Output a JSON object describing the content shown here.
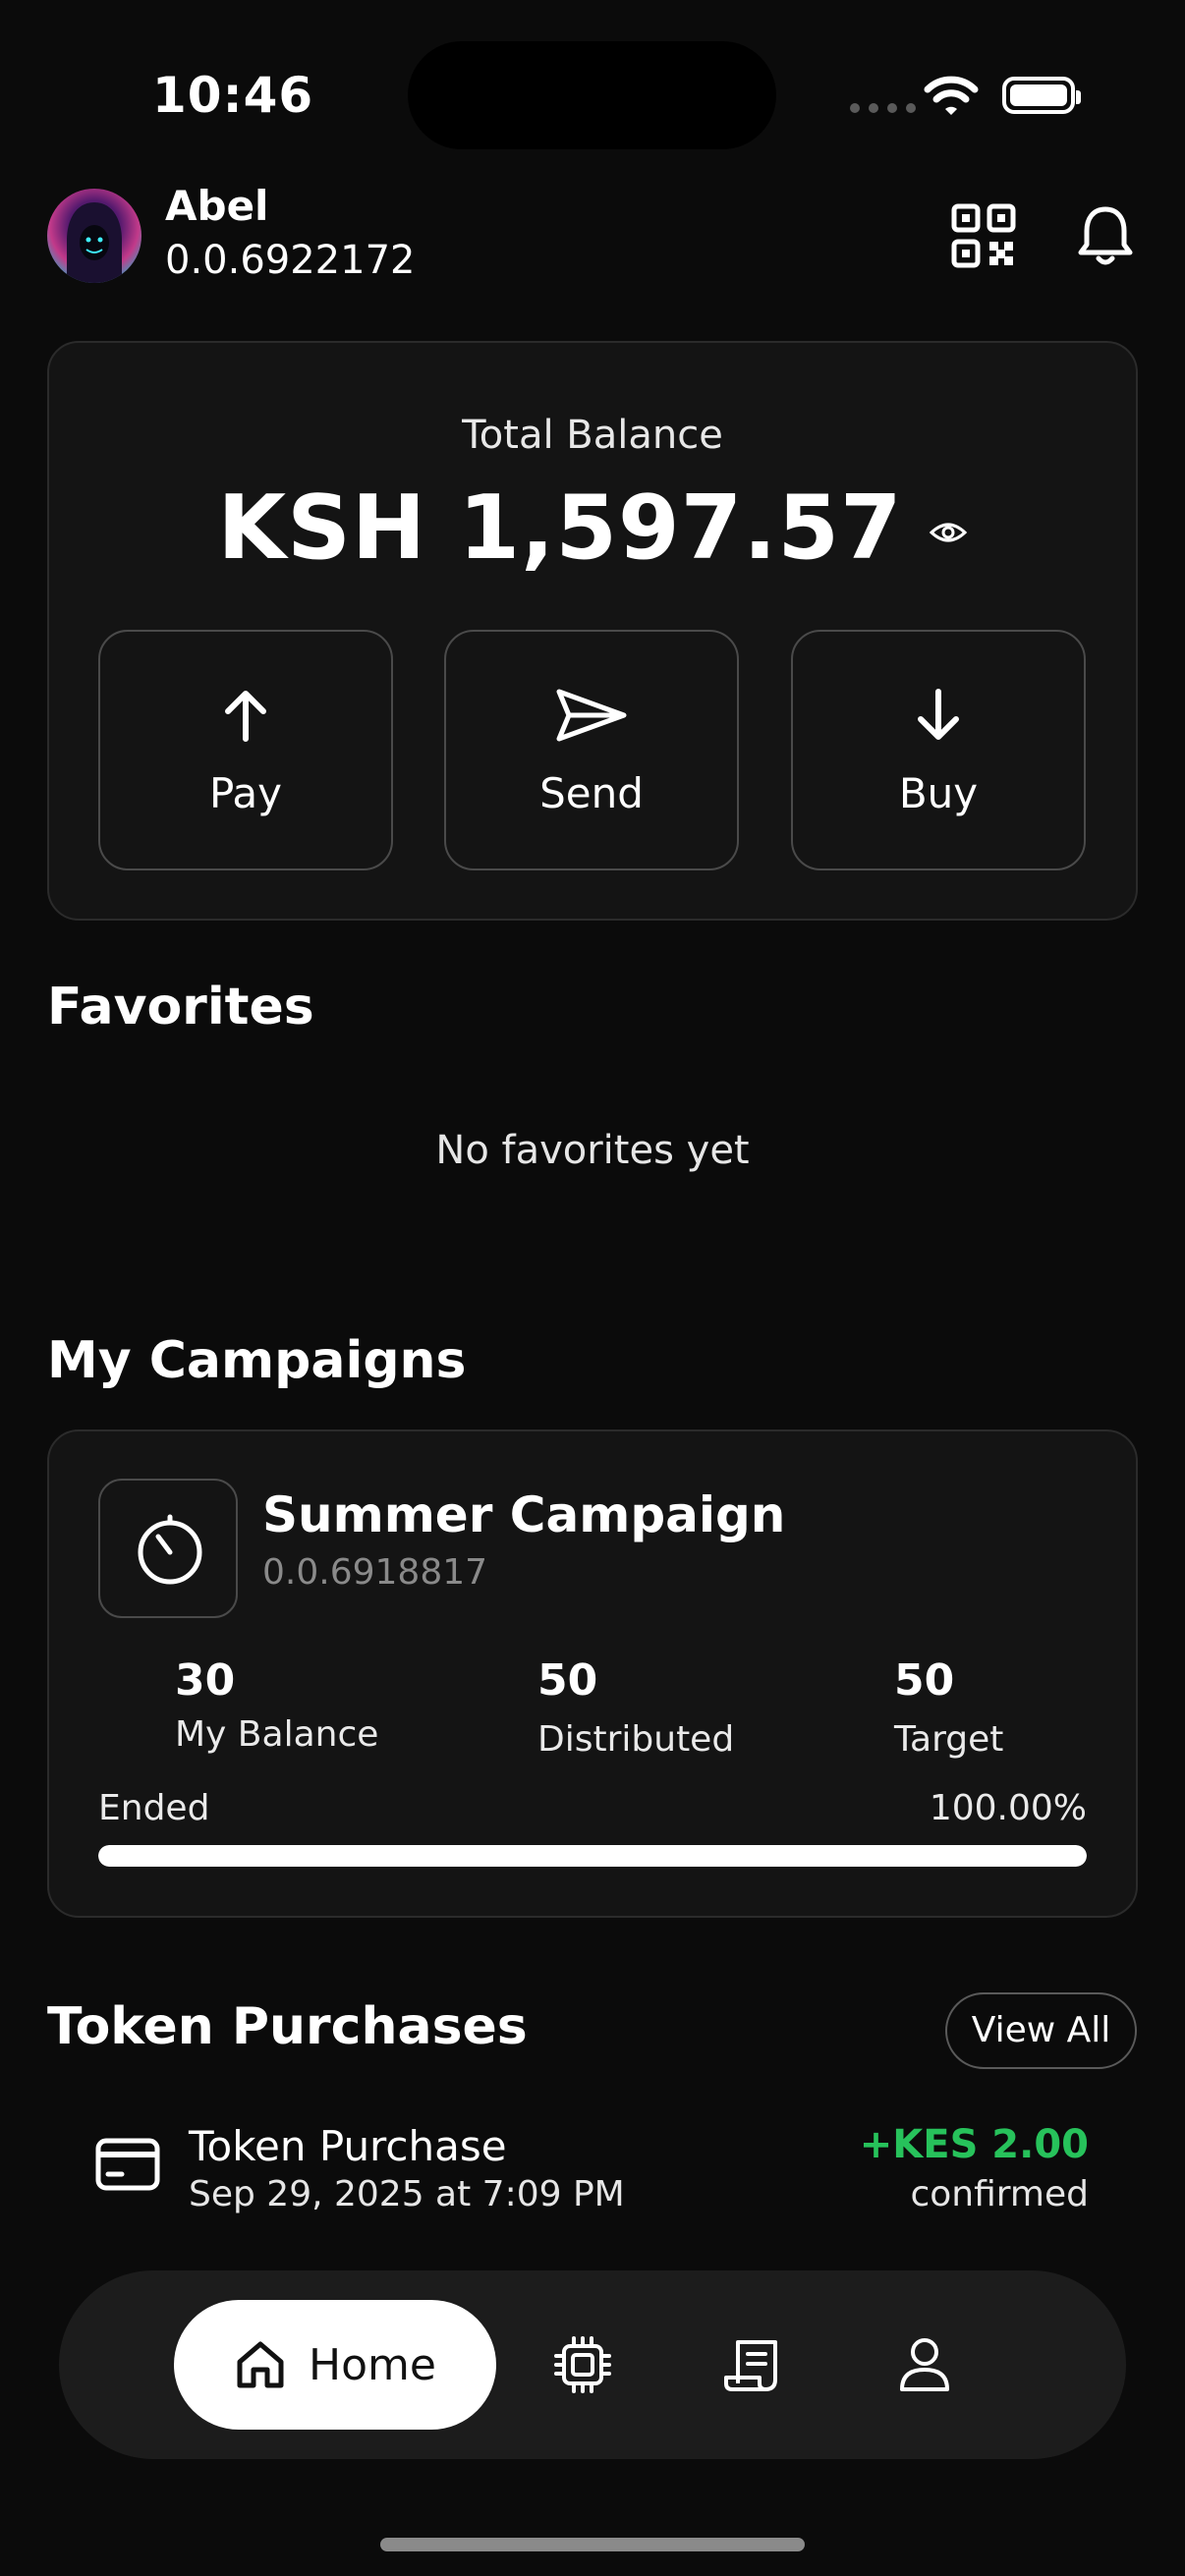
{
  "status_bar": {
    "time": "10:46"
  },
  "header": {
    "name": "Abel",
    "account_id": "0.0.6922172"
  },
  "balance": {
    "label": "Total Balance",
    "amount": "KSH 1,597.57",
    "actions": [
      {
        "label": "Pay",
        "icon": "arrow-up-icon"
      },
      {
        "label": "Send",
        "icon": "send-icon"
      },
      {
        "label": "Buy",
        "icon": "arrow-down-icon"
      }
    ]
  },
  "favorites": {
    "title": "Favorites",
    "empty_text": "No favorites yet"
  },
  "campaigns": {
    "title": "My Campaigns",
    "items": [
      {
        "name": "Summer Campaign",
        "id": "0.0.6918817",
        "stats": [
          {
            "value": "30",
            "label": "My Balance"
          },
          {
            "value": "50",
            "label": "Distributed"
          },
          {
            "value": "50",
            "label": "Target"
          }
        ],
        "status": "Ended",
        "progress_text": "100.00%",
        "progress": 1.0
      }
    ]
  },
  "token_purchases": {
    "title": "Token Purchases",
    "view_all": "View All",
    "items": [
      {
        "title": "Token Purchase",
        "date": "Sep 29, 2025 at 7:09 PM",
        "amount": "+KES 2.00",
        "status": "confirmed"
      }
    ]
  },
  "nav": {
    "items": [
      {
        "label": "Home",
        "icon": "home-icon",
        "active": true
      },
      {
        "label": "",
        "icon": "chip-icon",
        "active": false
      },
      {
        "label": "",
        "icon": "receipt-icon",
        "active": false
      },
      {
        "label": "",
        "icon": "user-icon",
        "active": false
      }
    ]
  },
  "colors": {
    "background": "#0b0b0b",
    "card": "#141414",
    "positive": "#27c25b",
    "active_tab": "#ffffff"
  }
}
